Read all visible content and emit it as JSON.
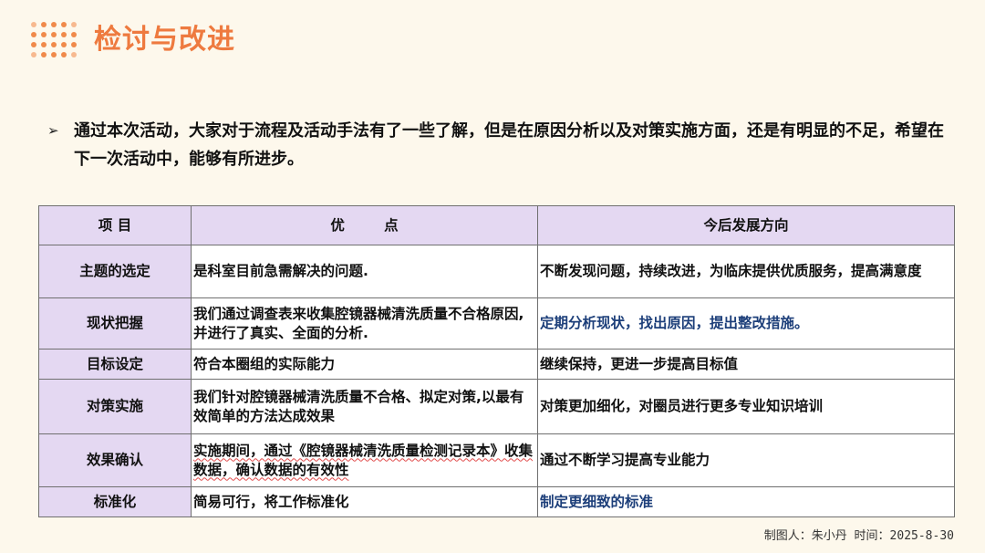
{
  "title": "检讨与改进",
  "intro": {
    "bullet_icon": "arrow-right-icon",
    "text": "通过本次活动，大家对于流程及活动手法有了一些了解，但是在原因分析以及对策实施方面，还是有明显的不足，希望在下一次活动中，能够有所进步。"
  },
  "table": {
    "headers": [
      "项  目",
      "优        点",
      "今后发展方向"
    ],
    "rows": [
      {
        "item": "主题的选定",
        "advantage": "是科室目前急需解决的问题.",
        "direction": "不断发现问题，持续改进，为临床提供优质服务，提高满意度"
      },
      {
        "item": "现状把握",
        "advantage": "我们通过调查表来收集腔镜器械清洗质量不合格原因,并进行了真实、全面的分析.",
        "direction": "定期分析现状，找出原因，提出整改措施。"
      },
      {
        "item": "目标设定",
        "advantage": "符合本圈组的实际能力",
        "direction": "继续保持，更进一步提高目标值"
      },
      {
        "item": "对策实施",
        "advantage": "我们针对腔镜器械清洗质量不合格、拟定对策,以最有效简单的方法达成效果",
        "direction": "对策更加细化，对圈员进行更多专业知识培训"
      },
      {
        "item": "效果确认",
        "advantage": "实施期间，通过《腔镜器械清洗质量检测记录本》收集数据，确认数据的有效性",
        "direction": "通过不断学习提高专业能力"
      },
      {
        "item": "标准化",
        "advantage": "简易可行，将工作标准化",
        "direction": "制定更细致的标准"
      }
    ]
  },
  "footer": "制图人：朱小丹 时间：2025-8-30",
  "colors": {
    "accent": "#ee7a3f",
    "header_bg": "#e4d8f2",
    "blue_text": "#1d3f7a",
    "background": "#fdf8ec"
  }
}
